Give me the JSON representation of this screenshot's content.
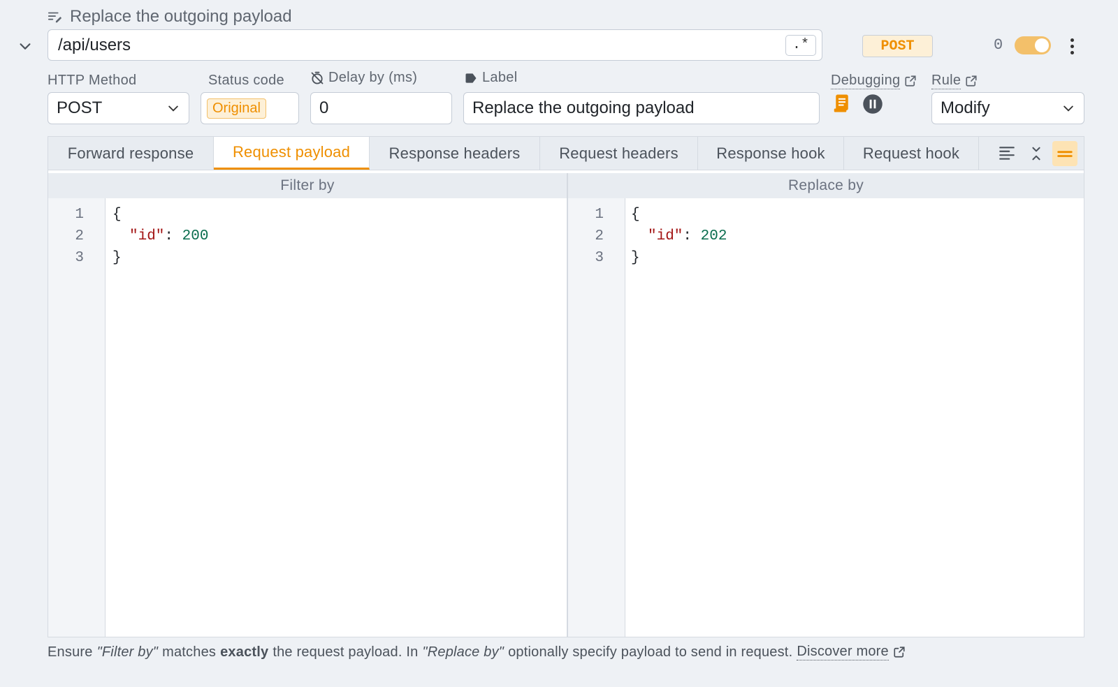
{
  "rule": {
    "title": "Replace the outgoing payload",
    "url": "/api/users",
    "regex_label": ".*",
    "method_badge": "POST",
    "hit_count": "0"
  },
  "fields": {
    "http_method_label": "HTTP Method",
    "http_method_value": "POST",
    "status_code_label": "Status code",
    "status_code_value": "Original",
    "delay_label": "Delay by (ms)",
    "delay_value": "0",
    "label_label": "Label",
    "label_value": "Replace the outgoing payload",
    "debugging_label": "Debugging",
    "rule_label": "Rule",
    "rule_value": "Modify"
  },
  "tabs": [
    {
      "label": "Forward response"
    },
    {
      "label": "Request payload",
      "active": true
    },
    {
      "label": "Response headers"
    },
    {
      "label": "Request headers"
    },
    {
      "label": "Response hook"
    },
    {
      "label": "Request hook"
    }
  ],
  "editor": {
    "left": {
      "header": "Filter by",
      "lines": [
        "1",
        "2",
        "3"
      ],
      "open": "{",
      "key": "\"id\"",
      "colon": ": ",
      "value": "200",
      "close": "}"
    },
    "right": {
      "header": "Replace by",
      "lines": [
        "1",
        "2",
        "3"
      ],
      "open": "{",
      "key": "\"id\"",
      "colon": ": ",
      "value": "202",
      "close": "}"
    }
  },
  "footer": {
    "t1": "Ensure",
    "t2": "\"Filter by\"",
    "t3": "matches",
    "t4": "exactly",
    "t5": "the request payload. In",
    "t6": "\"Replace by\"",
    "t7": "optionally specify payload to send in request.",
    "link": "Discover more"
  },
  "colors": {
    "accent": "#ef8f00",
    "toggle_on": "#f3c06a",
    "json_key": "#a31515",
    "json_number": "#0b6e4f"
  }
}
